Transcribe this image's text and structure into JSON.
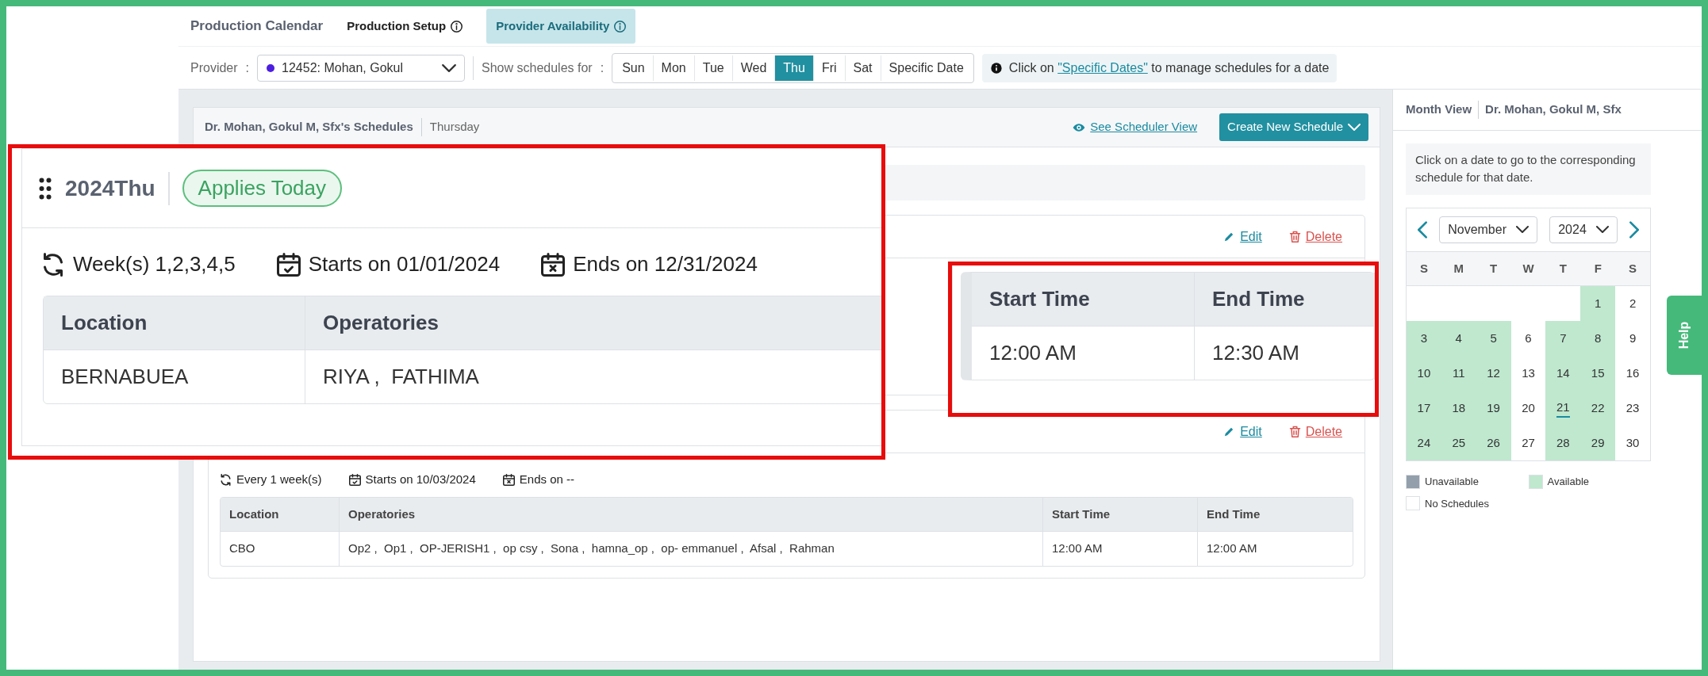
{
  "nav": {
    "title": "Production Calendar",
    "tabs": [
      {
        "label": "Production Setup",
        "selected": false
      },
      {
        "label": "Provider Availability",
        "selected": true
      }
    ]
  },
  "filters": {
    "provider_label": "Provider",
    "provider_sep": ":",
    "provider_value": "12452: Mohan, Gokul",
    "show_label": "Show schedules for",
    "show_sep": ":",
    "days": [
      {
        "label": "Sun",
        "selected": false
      },
      {
        "label": "Mon",
        "selected": false
      },
      {
        "label": "Tue",
        "selected": false
      },
      {
        "label": "Wed",
        "selected": false
      },
      {
        "label": "Thu",
        "selected": true
      },
      {
        "label": "Fri",
        "selected": false
      },
      {
        "label": "Sat",
        "selected": false
      },
      {
        "label": "Specific Date",
        "selected": false
      }
    ],
    "hint_prefix": "Click on",
    "hint_link": "\"Specific Dates\"",
    "hint_suffix": "to manage schedules for a date"
  },
  "schedules_header": {
    "title": "Dr. Mohan, Gokul M, Sfx's Schedules",
    "day": "Thursday",
    "scheduler_link": "See Scheduler View",
    "create_button": "Create New Schedule"
  },
  "schedules": [
    {
      "edit": "Edit",
      "delete": "Delete"
    },
    {
      "edit": "Edit",
      "delete": "Delete",
      "recurrence": "Every 1 week(s)",
      "starts": "Starts on 10/03/2024",
      "ends": "Ends on --",
      "columns": [
        "Location",
        "Operatories",
        "Start Time",
        "End Time"
      ],
      "rows": [
        [
          "CBO",
          "Op2 ,  Op1 ,  OP-JERISH1 ,  op csy ,  Sona ,  hamna_op ,  op- emmanuel ,  Afsal ,  Rahman",
          "12:00 AM",
          "12:00 AM"
        ]
      ]
    }
  ],
  "callouts": [
    {
      "kind": "summary",
      "title": "2024Thu",
      "badge": "Applies Today",
      "recurrence": "Week(s) 1,2,3,4,5",
      "starts": "Starts on 01/01/2024",
      "ends": "Ends on 12/31/2024",
      "columns": [
        "Location",
        "Operatories"
      ],
      "rows": [
        [
          "BERNABUEA",
          "RIYA ,  FATHIMA"
        ]
      ]
    },
    {
      "kind": "times",
      "columns": [
        "Start Time",
        "End Time"
      ],
      "rows": [
        [
          "12:00 AM",
          "12:30 AM"
        ]
      ]
    }
  ],
  "month_view": {
    "title": "Month View",
    "provider": "Dr. Mohan, Gokul M, Sfx",
    "info": "Click on a date to go to the corresponding schedule for that date.",
    "month": "November",
    "year": "2024",
    "weekdays": [
      "S",
      "M",
      "T",
      "W",
      "T",
      "F",
      "S"
    ],
    "weeks": [
      [
        {
          "day": "1",
          "available": true,
          "today": false
        },
        {
          "day": "2",
          "available": false,
          "today": false
        }
      ],
      [
        {
          "day": "3",
          "available": true,
          "today": false
        },
        {
          "day": "4",
          "available": true,
          "today": false
        },
        {
          "day": "5",
          "available": true,
          "today": false
        },
        {
          "day": "6",
          "available": false,
          "today": false
        },
        {
          "day": "7",
          "available": true,
          "today": false
        },
        {
          "day": "8",
          "available": true,
          "today": false
        },
        {
          "day": "9",
          "available": false,
          "today": false
        }
      ],
      [
        {
          "day": "10",
          "available": true,
          "today": false
        },
        {
          "day": "11",
          "available": true,
          "today": false
        },
        {
          "day": "12",
          "available": true,
          "today": false
        },
        {
          "day": "13",
          "available": false,
          "today": false
        },
        {
          "day": "14",
          "available": true,
          "today": false
        },
        {
          "day": "15",
          "available": true,
          "today": false
        },
        {
          "day": "16",
          "available": false,
          "today": false
        }
      ],
      [
        {
          "day": "17",
          "available": true,
          "today": false
        },
        {
          "day": "18",
          "available": true,
          "today": false
        },
        {
          "day": "19",
          "available": true,
          "today": false
        },
        {
          "day": "20",
          "available": false,
          "today": false
        },
        {
          "day": "21",
          "available": true,
          "today": true
        },
        {
          "day": "22",
          "available": true,
          "today": false
        },
        {
          "day": "23",
          "available": false,
          "today": false
        }
      ],
      [
        {
          "day": "24",
          "available": true,
          "today": false
        },
        {
          "day": "25",
          "available": true,
          "today": false
        },
        {
          "day": "26",
          "available": true,
          "today": false
        },
        {
          "day": "27",
          "available": false,
          "today": false
        },
        {
          "day": "28",
          "available": true,
          "today": false
        },
        {
          "day": "29",
          "available": true,
          "today": false
        },
        {
          "day": "30",
          "available": false,
          "today": false
        }
      ]
    ],
    "legend": [
      {
        "label": "Unavailable",
        "color": "#939fab"
      },
      {
        "label": "Available",
        "color": "#bfe8cf"
      },
      {
        "label": "No Schedules",
        "color": "#ffffff"
      }
    ]
  },
  "help": "Help"
}
